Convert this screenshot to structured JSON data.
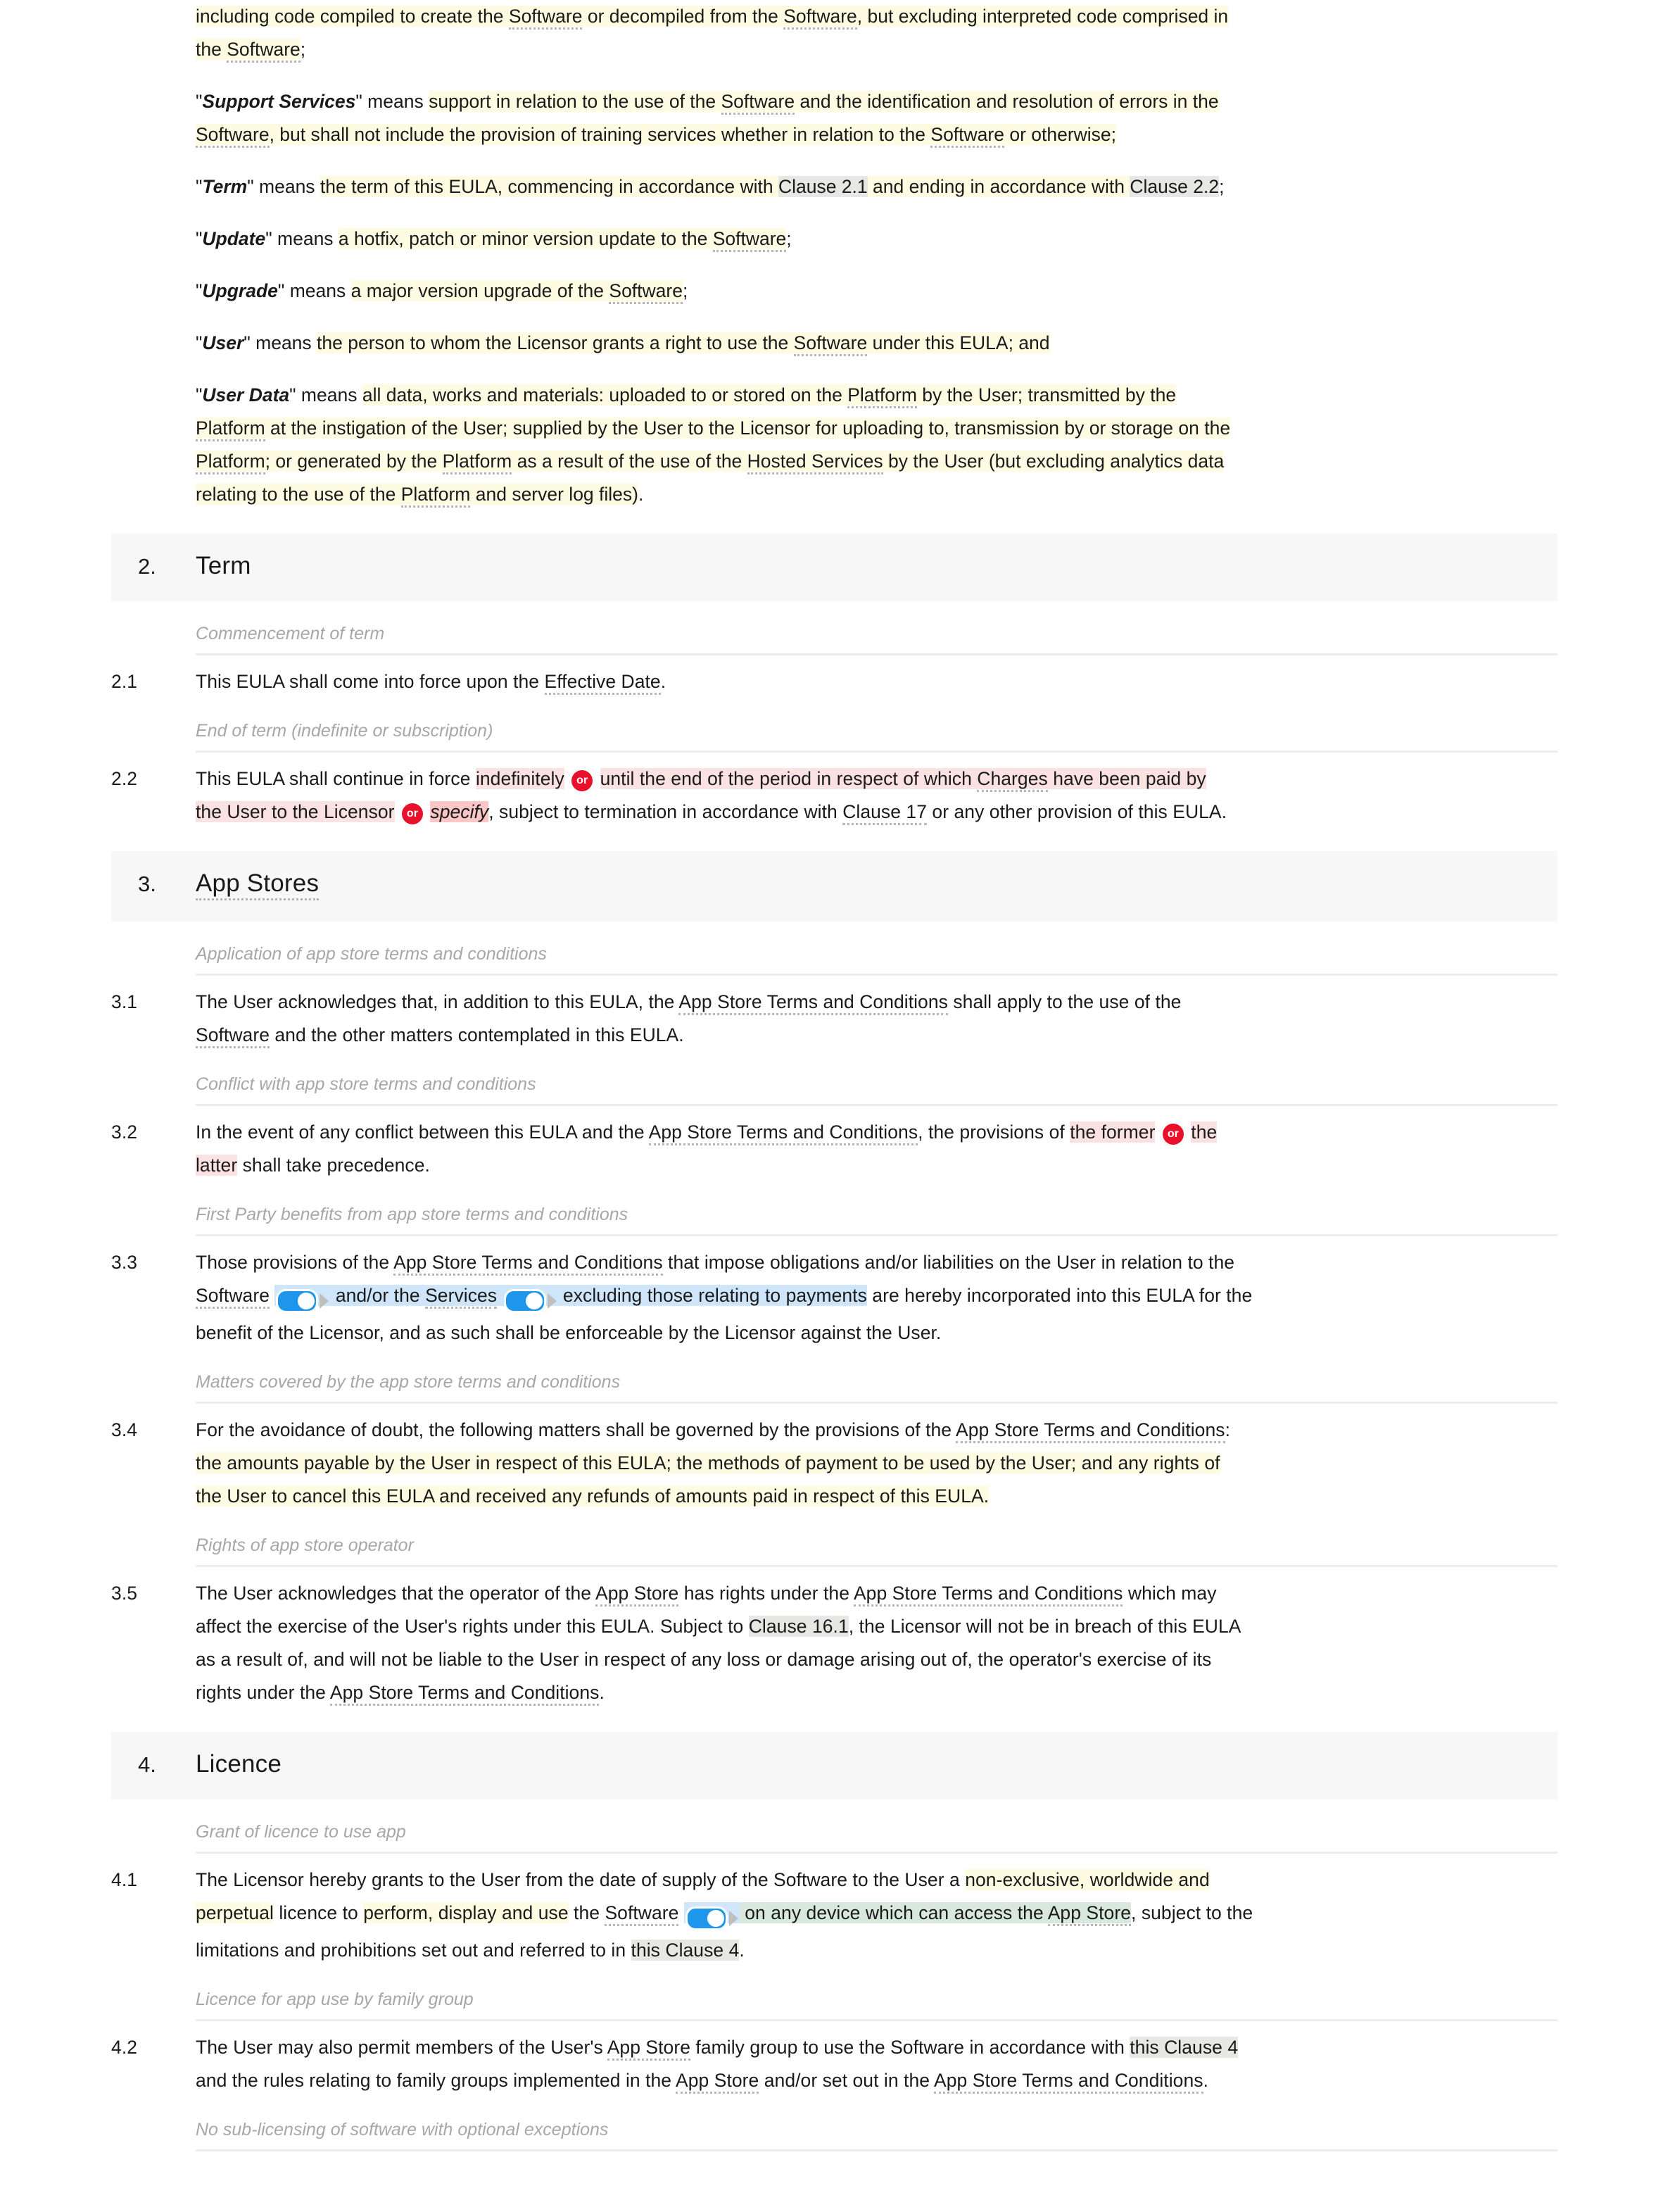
{
  "document": {
    "type": "EULA legal contract",
    "definitions": [
      {
        "id": "def-software-tail",
        "text_parts": [
          {
            "t": "including code compiled to create the ",
            "style": "hl-y"
          },
          {
            "t": "Software",
            "style": "hl-y dt"
          },
          {
            "t": " or decompiled from the ",
            "style": "hl-y"
          },
          {
            "t": "Software",
            "style": "hl-y dt"
          },
          {
            "t": ", but excluding interpreted code comprised in the ",
            "style": "hl-y"
          },
          {
            "t": "Software",
            "style": "hl-y dt"
          },
          {
            "t": ";",
            "style": ""
          }
        ]
      },
      {
        "id": "def-support-services",
        "term": "Support Services",
        "lead": "\" means ",
        "text": "support in relation to the use of the Software and the identification and resolution of errors in the Software, but shall not include the provision of training services whether in relation to the Software or otherwise;"
      },
      {
        "id": "def-term",
        "term": "Term",
        "text": "the term of this EULA, commencing in accordance with Clause 2.1 and ending in accordance with Clause 2.2;"
      },
      {
        "id": "def-update",
        "term": "Update",
        "text": "a hotfix, patch or minor version update to the Software;"
      },
      {
        "id": "def-upgrade",
        "term": "Upgrade",
        "text": "a major version upgrade of the Software;"
      },
      {
        "id": "def-user",
        "term": "User",
        "text": "the person to whom the Licensor grants a right to use the Software under this EULA; and"
      },
      {
        "id": "def-user-data",
        "term": "User Data",
        "text": "all data, works and materials: uploaded to or stored on the Platform by the User; transmitted by the Platform at the instigation of the User; supplied by the User to the Licensor for uploading to, transmission by or storage on the Platform; or generated by the Platform as a result of the use of the Hosted Services by the User (but excluding analytics data relating to the use of the Platform and server log files)."
      }
    ],
    "sections": [
      {
        "number": "2.",
        "title": "Term",
        "title_is_defined_term": false,
        "clauses": [
          {
            "subhead": "Commencement of term",
            "number": "2.1",
            "text": "This EULA shall come into force upon the Effective Date."
          },
          {
            "subhead": "End of term (indefinite or subscription)",
            "number": "2.2",
            "text": "This EULA shall continue in force indefinitely or until the end of the period in respect of which Charges have been paid by the User to the Licensor or specify, subject to termination in accordance with Clause 17 or any other provision of this EULA."
          }
        ]
      },
      {
        "number": "3.",
        "title": "App Stores",
        "title_is_defined_term": true,
        "clauses": [
          {
            "subhead": "Application of app store terms and conditions",
            "number": "3.1",
            "text": "The User acknowledges that, in addition to this EULA, the App Store Terms and Conditions shall apply to the use of the Software and the other matters contemplated in this EULA."
          },
          {
            "subhead": "Conflict with app store terms and conditions",
            "number": "3.2",
            "text": "In the event of any conflict between this EULA and the App Store Terms and Conditions, the provisions of the former or the latter shall take precedence."
          },
          {
            "subhead": "First Party benefits from app store terms and conditions",
            "number": "3.3",
            "text": "Those provisions of the App Store Terms and Conditions that impose obligations and/or liabilities on the User in relation to the Software and/or the Services excluding those relating to payments are hereby incorporated into this EULA for the benefit of the Licensor, and as such shall be enforceable by the Licensor against the User."
          },
          {
            "subhead": "Matters covered by the app store terms and conditions",
            "number": "3.4",
            "text": "For the avoidance of doubt, the following matters shall be governed by the provisions of the App Store Terms and Conditions: the amounts payable by the User in respect of this EULA; the methods of payment to be used by the User; and any rights of the User to cancel this EULA and received any refunds of amounts paid in respect of this EULA."
          },
          {
            "subhead": "Rights of app store operator",
            "number": "3.5",
            "text": "The User acknowledges that the operator of the App Store has rights under the App Store Terms and Conditions which may affect the exercise of the User's rights under this EULA. Subject to Clause 16.1, the Licensor will not be in breach of this EULA as a result of, and will not be liable to the User in respect of any loss or damage arising out of, the operator's exercise of its rights under the App Store Terms and Conditions."
          }
        ]
      },
      {
        "number": "4.",
        "title": "Licence",
        "title_is_defined_term": false,
        "clauses": [
          {
            "subhead": "Grant of licence to use app",
            "number": "4.1",
            "text": "The Licensor hereby grants to the User from the date of supply of the Software to the User a non-exclusive, worldwide and perpetual licence to perform, display and use the Software on any device which can access the App Store, subject to the limitations and prohibitions set out and referred to in this Clause 4."
          },
          {
            "subhead": "Licence for app use by family group",
            "number": "4.2",
            "text": "The User may also permit members of the User's App Store family group to use the Software in accordance with this Clause 4 and the rules relating to family groups implemented in the App Store and/or set out in the App Store Terms and Conditions."
          },
          {
            "subhead": "No sub-licensing of software with optional exceptions",
            "number": "",
            "text": ""
          }
        ]
      }
    ],
    "labels": {
      "or_badge": "or",
      "means": "means",
      "quote": "\""
    },
    "colors": {
      "highlight_yellow": "#fdfce3",
      "highlight_grey": "#e7e7e3",
      "highlight_pink": "#fbe2e2",
      "highlight_pink_strong": "#fac6c6",
      "highlight_blue": "#cfe6fa",
      "highlight_green": "#d8e8dc",
      "or_badge_red": "#e8102a",
      "toggle_blue": "#1e96eb",
      "section_band": "#f7f7f7",
      "subhead_grey": "#a7a7a7",
      "rule_grey": "#ededed",
      "dotted_underline": "#b6b6b6"
    }
  }
}
